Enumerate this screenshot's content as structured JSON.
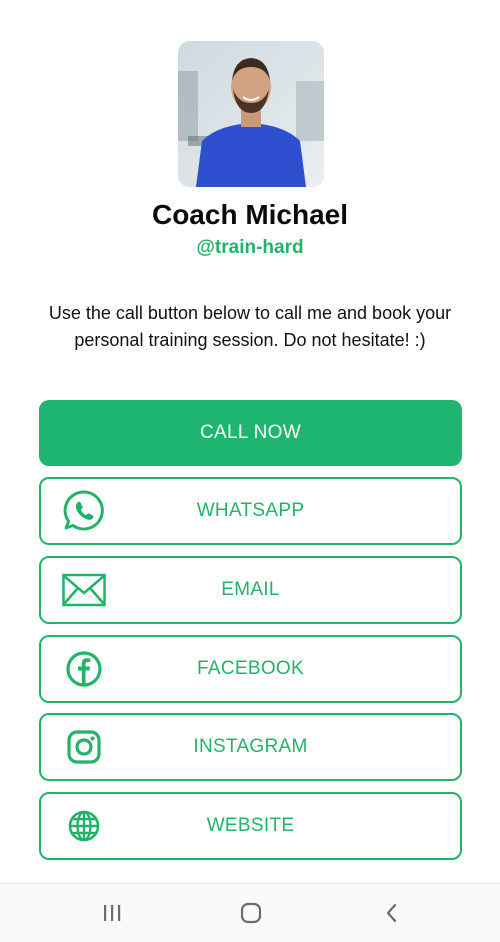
{
  "profile": {
    "name": "Coach Michael",
    "handle": "@train-hard",
    "bio": "Use the call button below to call me and book your personal training session. Do not hesitate! :)",
    "accent_color": "#22b36a"
  },
  "buttons": {
    "call": "CALL NOW",
    "whatsapp": "WHATSAPP",
    "email": "EMAIL",
    "facebook": "FACEBOOK",
    "instagram": "INSTAGRAM",
    "website": "WEBSITE"
  },
  "icons": {
    "whatsapp": "whatsapp-icon",
    "email": "envelope-icon",
    "facebook": "facebook-icon",
    "instagram": "instagram-icon",
    "website": "globe-icon"
  },
  "navigation": {
    "recent": "recent-apps-icon",
    "home": "home-icon",
    "back": "back-icon"
  }
}
